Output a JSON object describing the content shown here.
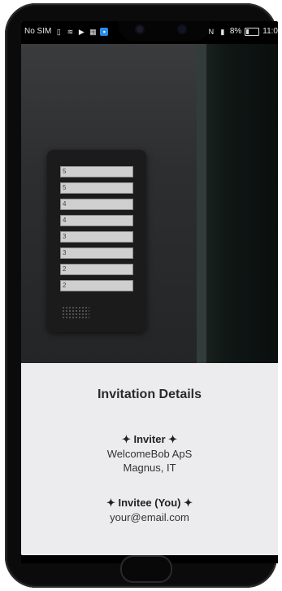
{
  "status_bar": {
    "carrier": "No SIM",
    "left_icons": [
      "sim-card-icon",
      "wifi-icon",
      "play-icon",
      "gallery-icon",
      "app-icon"
    ],
    "right_icons": [
      "nfc-icon",
      "vibrate-icon"
    ],
    "battery": "8%",
    "time": "11:0"
  },
  "photo": {
    "description_name": "intercom-panel-photo",
    "panel_rows": [
      "5",
      "5",
      "4",
      "4",
      "3",
      "3",
      "2",
      "2"
    ]
  },
  "invitation": {
    "title": "Invitation Details",
    "inviter_heading": "✦ Inviter ✦",
    "inviter_company": "WelcomeBob ApS",
    "inviter_person": "Magnus, IT",
    "invitee_heading": "✦ Invitee (You) ✦",
    "invitee_email": "your@email.com"
  },
  "colors": {
    "details_background": "#ecebee",
    "phone_frame": "#0b0b0b",
    "status_accent": "#2a8ce6"
  }
}
